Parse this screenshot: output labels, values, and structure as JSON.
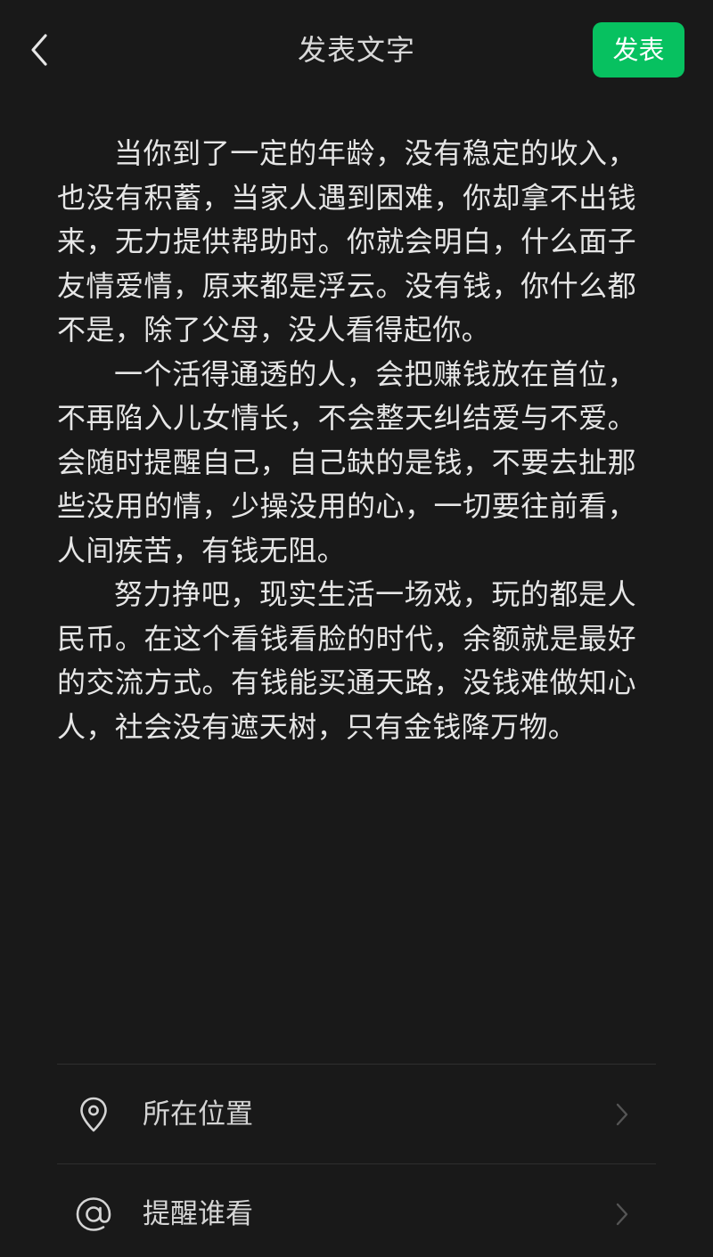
{
  "header": {
    "title": "发表文字",
    "back_icon": "chevron-left-icon",
    "publish_label": "发表"
  },
  "post": {
    "paragraphs": [
      "当你到了一定的年龄，没有稳定的收入，也没有积蓄，当家人遇到困难，你却拿不出钱来，无力提供帮助时。你就会明白，什么面子友情爱情，原来都是浮云。没有钱，你什么都不是，除了父母，没人看得起你。",
      "一个活得通透的人，会把赚钱放在首位，不再陷入儿女情长，不会整天纠结爱与不爱。会随时提醒自己，自己缺的是钱，不要去扯那些没用的情，少操没用的心，一切要往前看，人间疾苦，有钱无阻。",
      "努力挣吧，现实生活一场戏，玩的都是人民币。在这个看钱看脸的时代，余额就是最好的交流方式。有钱能买通天路，没钱难做知心人，社会没有遮天树，只有金钱降万物。"
    ]
  },
  "options": [
    {
      "label": "所在位置",
      "icon": "location-pin-icon"
    },
    {
      "label": "提醒谁看",
      "icon": "at-sign-icon"
    }
  ],
  "colors": {
    "background": "#191919",
    "accent": "#07c160",
    "text": "#e6e6e6"
  }
}
